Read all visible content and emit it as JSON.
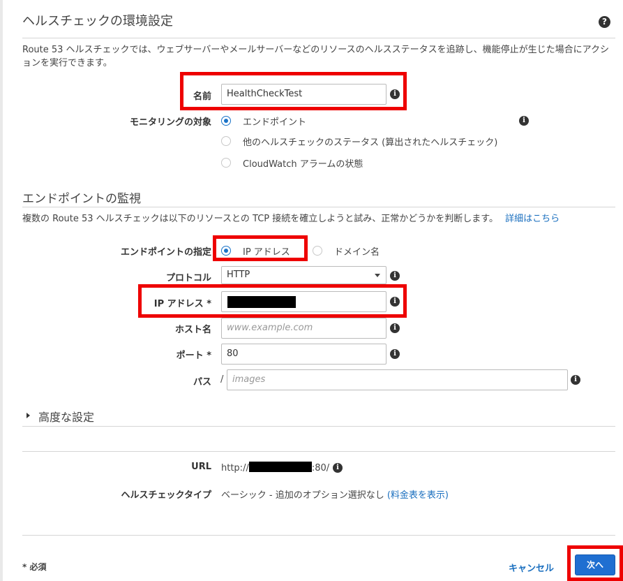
{
  "header": {
    "title": "ヘルスチェックの環境設定",
    "description": "Route 53 ヘルスチェックでは、ウェブサーバーやメールサーバーなどのリソースのヘルスステータスを追跡し、機能停止が生じた場合にアクションを実行できます。"
  },
  "name_field": {
    "label": "名前",
    "value": "HealthCheckTest"
  },
  "monitor": {
    "label": "モニタリングの対象",
    "options": [
      "エンドポイント",
      "他のヘルスチェックのステータス (算出されたヘルスチェック)",
      "CloudWatch アラームの状態"
    ],
    "selected": "エンドポイント"
  },
  "endpoint_section": {
    "title": "エンドポイントの監視",
    "description": "複数の Route 53 ヘルスチェックは以下のリソースとの TCP 接続を確立しようと試み、正常かどうかを判断します。",
    "learn_more": "詳細はこちら"
  },
  "specify": {
    "label": "エンドポイントの指定",
    "options": [
      "IP アドレス",
      "ドメイン名"
    ],
    "selected": "IP アドレス"
  },
  "protocol": {
    "label": "プロトコル",
    "value": "HTTP"
  },
  "ip": {
    "label": "IP アドレス *"
  },
  "host": {
    "label": "ホスト名",
    "placeholder": "www.example.com"
  },
  "port": {
    "label": "ポート *",
    "value": "80"
  },
  "path": {
    "label": "パス",
    "prefix": "/",
    "placeholder": "images"
  },
  "advanced": {
    "label": "高度な設定"
  },
  "url": {
    "label": "URL",
    "prefix": "http://",
    "suffix": ":80/"
  },
  "type": {
    "label": "ヘルスチェックタイプ",
    "value": "ベーシック - 追加のオプション選択なし",
    "pricing_link": "(料金表を表示)"
  },
  "footer": {
    "required_note": "* 必須",
    "cancel": "キャンセル",
    "next": "次へ"
  },
  "colors": {
    "highlight": "#ee0000",
    "accent": "#1a73c8",
    "link": "#1a6fbf",
    "primary_button": "#1f6fd1"
  },
  "icons": {
    "info": "info-icon",
    "help": "help-icon",
    "radio": "radio-icon",
    "caret": "caret-right-icon"
  }
}
